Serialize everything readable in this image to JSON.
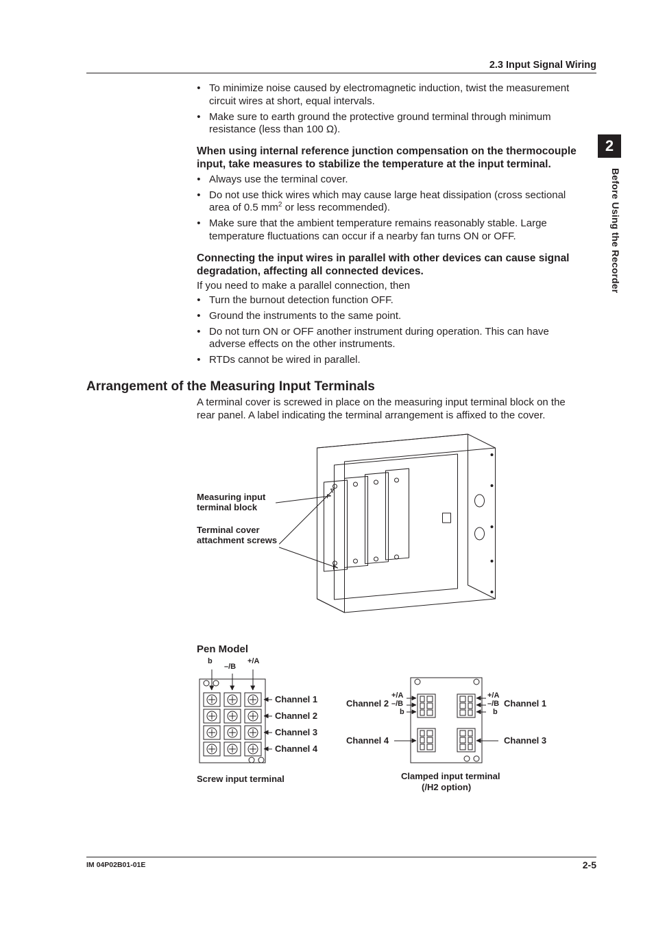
{
  "header": {
    "section_ref": "2.3  Input Signal Wiring"
  },
  "sidebar": {
    "chapter_number": "2",
    "chapter_title": "Before Using the Recorder"
  },
  "noise_bullets": [
    "To minimize noise caused by electromagnetic induction, twist the measurement circuit wires at short, equal intervals.",
    "Make sure to earth ground the protective ground terminal through minimum resistance (less than 100 Ω)."
  ],
  "thermocouple": {
    "heading": "When using internal reference junction compensation on the thermocouple input, take measures to stabilize the temperature at the input terminal.",
    "bullets": [
      "Always use the terminal cover.",
      "Do not use thick wires which may cause large heat dissipation (cross sectional area of 0.5 mm² or less recommended).",
      "Make sure that the ambient temperature remains reasonably stable. Large temperature fluctuations can occur if a nearby fan turns ON or OFF."
    ]
  },
  "parallel": {
    "heading": "Connecting the input wires in parallel with other devices can cause signal degradation, affecting all connected devices.",
    "intro": "If you need to make a parallel connection, then",
    "bullets": [
      "Turn the burnout detection function OFF.",
      "Ground the instruments to the same point.",
      "Do not turn ON or OFF another instrument during operation. This can have adverse effects on the other instruments.",
      "RTDs cannot be wired in parallel."
    ]
  },
  "arrangement": {
    "heading": "Arrangement of the Measuring Input Terminals",
    "body": "A terminal cover is screwed in place on the measuring input terminal block on the rear panel. A label indicating the terminal arrangement is affixed to the cover."
  },
  "fig1": {
    "callout_block": "Measuring input terminal block",
    "callout_screws": "Terminal cover attachment screws"
  },
  "pen_model": {
    "title": "Pen Model",
    "left": {
      "caption": "Screw input terminal",
      "pins": {
        "b": "b",
        "mB": "–/B",
        "pA": "+/A"
      },
      "channels": [
        "Channel 1",
        "Channel 2",
        "Channel 3",
        "Channel 4"
      ]
    },
    "right": {
      "caption_line1": "Clamped input terminal",
      "caption_line2": "(/H2 option)",
      "pins_left": {
        "b": "b",
        "mB": "–/B",
        "pA": "+/A"
      },
      "pins_right": {
        "b": "b",
        "mB": "–/B",
        "pA": "+/A"
      },
      "ch_left_top": "Channel 2",
      "ch_left_bottom": "Channel 4",
      "ch_right_top": "Channel 1",
      "ch_right_bottom": "Channel 3"
    }
  },
  "footer": {
    "docid": "IM 04P02B01-01E",
    "page": "2-5"
  }
}
